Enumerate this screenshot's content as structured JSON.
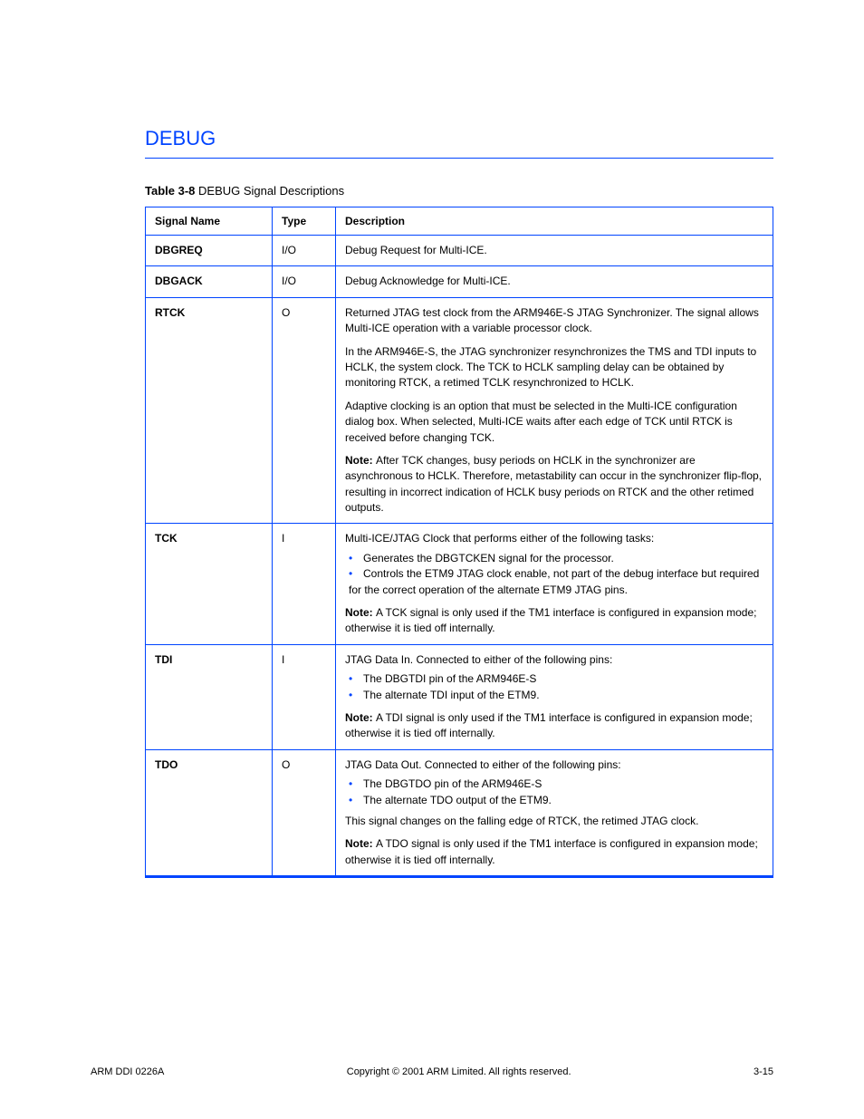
{
  "section_title": "DEBUG",
  "table_caption_label": "Table 3-8",
  "table_caption_text": "DEBUG Signal Descriptions",
  "columns": {
    "c1": "Signal Name",
    "c2": "Type",
    "c3": "Description"
  },
  "rows": [
    {
      "name": "DBGREQ",
      "type": "I/O",
      "desc": "Debug Request for Multi-ICE."
    },
    {
      "name": "DBGACK",
      "type": "I/O",
      "desc": "Debug Acknowledge for Multi-ICE."
    },
    {
      "name": "RTCK",
      "type": "O",
      "desc_paragraphs": [
        "Returned JTAG test clock from the ARM946E-S JTAG Synchronizer. The signal allows Multi-ICE operation with a variable processor clock.",
        "In the ARM946E-S, the JTAG synchronizer resynchronizes the TMS and TDI inputs to HCLK, the system clock. The TCK to HCLK sampling delay can be obtained by monitoring RTCK, a retimed TCLK resynchronized to HCLK.",
        "Adaptive clocking is an option that must be selected in the Multi-ICE configuration dialog box. When selected, Multi-ICE waits after each edge of TCK until RTCK is received before changing TCK."
      ],
      "note": "After TCK changes, busy periods on HCLK in the synchronizer are asynchronous to HCLK. Therefore, metastability can occur in the synchronizer flip-flop, resulting in incorrect indication of HCLK busy periods on RTCK and the other retimed outputs."
    },
    {
      "name": "TCK",
      "type": "I",
      "desc_intro": "Multi-ICE/JTAG Clock that performs either of the following tasks:",
      "bullets": [
        "Generates the DBGTCKEN signal for the processor.",
        "Controls the ETM9 JTAG clock enable, not part of the debug interface but required for the correct operation of the alternate ETM9 JTAG pins."
      ],
      "note": "A TCK signal is only used if the TM1 interface is configured in expansion mode; otherwise it is tied off internally."
    },
    {
      "name": "TDI",
      "type": "I",
      "desc_intro": "JTAG Data In. Connected to either of the following pins:",
      "bullets": [
        "The DBGTDI pin of the ARM946E-S",
        "The alternate TDI input of the ETM9."
      ],
      "note": "A TDI signal is only used if the TM1 interface is configured in expansion mode; otherwise it is tied off internally."
    },
    {
      "name": "TDO",
      "type": "O",
      "desc_intro": "JTAG Data Out. Connected to either of the following pins:",
      "bullets": [
        "The DBGTDO pin of the ARM946E-S",
        "The alternate TDO output of the ETM9."
      ],
      "trailing": "This signal changes on the falling edge of RTCK, the retimed JTAG clock.",
      "note": "A TDO signal is only used if the TM1 interface is configured in expansion mode; otherwise it is tied off internally."
    }
  ],
  "footer": {
    "left": "ARM DDI 0226A",
    "center": "Copyright © 2001 ARM Limited. All rights reserved.",
    "right": "3-15"
  }
}
